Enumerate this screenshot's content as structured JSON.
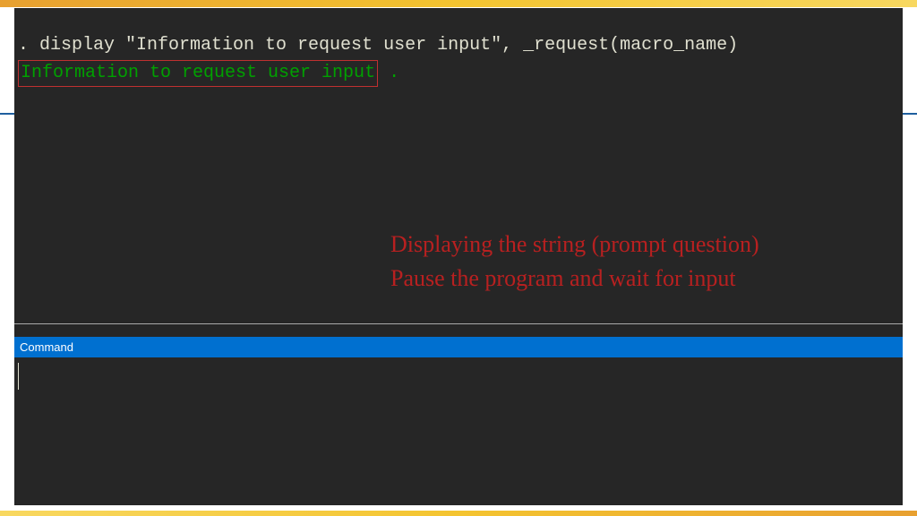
{
  "results": {
    "command_line": ". display \"Information to request user input\", _request(macro_name)",
    "output_highlighted": "Information to request user input",
    "output_trailing": " ."
  },
  "annotations": {
    "line1": "Displaying the string (prompt question)",
    "line2": "Pause the program and wait for input"
  },
  "command_panel": {
    "title": "Command",
    "value": ""
  },
  "colors": {
    "terminal_bg": "#262626",
    "header_blue": "#0070d0",
    "output_green": "#00a000",
    "annotation_red": "#b82020",
    "box_red": "#c03030"
  }
}
